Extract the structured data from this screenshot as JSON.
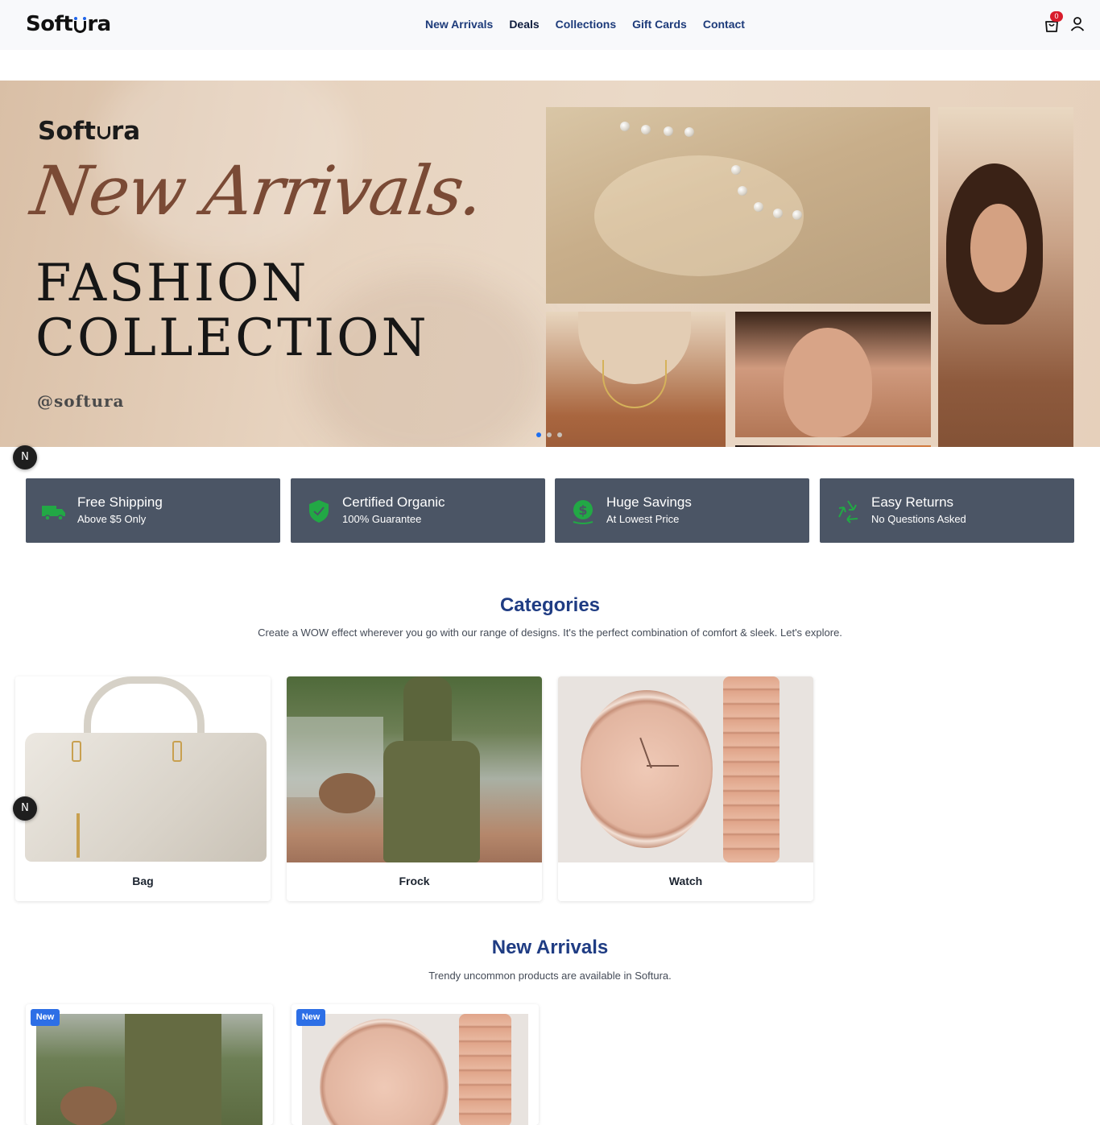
{
  "header": {
    "logo_left": "Soft",
    "logo_right": "ra",
    "nav": [
      "New Arrivals",
      "Deals",
      "Collections",
      "Gift Cards",
      "Contact"
    ],
    "cart_count": "0"
  },
  "hero": {
    "logo_left": "Soft",
    "logo_right": "ra",
    "script": "New Arrivals.",
    "title_line1": "FASHION",
    "title_line2": "COLLECTION",
    "handle": "@softura",
    "slides_total": 3,
    "active_slide": 1
  },
  "badge_letter": "N",
  "features": [
    {
      "title": "Free Shipping",
      "subtitle": "Above $5 Only",
      "icon": "truck-icon"
    },
    {
      "title": "Certified Organic",
      "subtitle": "100% Guarantee",
      "icon": "shield-check-icon"
    },
    {
      "title": "Huge Savings",
      "subtitle": "At Lowest Price",
      "icon": "dollar-coin-icon"
    },
    {
      "title": "Easy Returns",
      "subtitle": "No Questions Asked",
      "icon": "recycle-icon"
    }
  ],
  "categories": {
    "title": "Categories",
    "subtitle": "Create a WOW effect wherever you go with our range of designs. It's the perfect combination of comfort & sleek. Let's explore.",
    "items": [
      {
        "label": "Bag"
      },
      {
        "label": "Frock"
      },
      {
        "label": "Watch"
      }
    ]
  },
  "new_arrivals": {
    "title": "New Arrivals",
    "subtitle": "Trendy uncommon products are available in Softura.",
    "badge": "New"
  },
  "colors": {
    "nav": "#1d3b7a",
    "section_title": "#1f3c83",
    "feature_bg": "#4b5565",
    "feature_icon": "#22a845",
    "badge_blue": "#2d6fe6",
    "cart_badge": "#d81c2b"
  }
}
